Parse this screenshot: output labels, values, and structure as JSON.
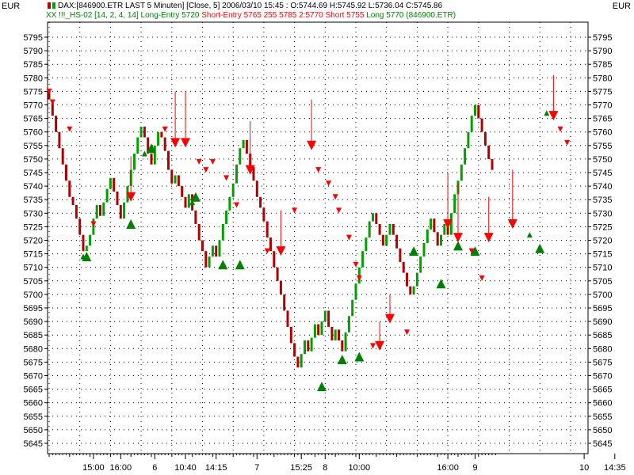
{
  "chart_data": {
    "type": "candlestick",
    "currency_left": "EUR",
    "currency_right": "EUR",
    "title": "DAX:[846900.ETR LAST 5 Minuten] [Close, 5] 2006/03/10 15:45 : O:5744.69 H:5745.92 L:5736.04 C:5745.86",
    "indicator": {
      "name": "XX !!!_HS-02 [14, 2, 4, 14]",
      "long_entry": "Long-Entry 5720",
      "short_entry": "Short-Entry 5765 255 5785 2:5770",
      "short": "Short 5755",
      "long": "Long 5770 (846900.ETR)"
    },
    "ylim": [
      5640,
      5800
    ],
    "y_ticks": [
      5795,
      5790,
      5785,
      5780,
      5775,
      5770,
      5765,
      5760,
      5755,
      5750,
      5745,
      5740,
      5735,
      5730,
      5725,
      5720,
      5715,
      5710,
      5705,
      5700,
      5695,
      5690,
      5685,
      5680,
      5675,
      5670,
      5665,
      5660,
      5655,
      5650,
      5645
    ],
    "x_labels": [
      {
        "i": 13,
        "text": "15:00"
      },
      {
        "i": 21,
        "text": "16:00"
      },
      {
        "i": 31,
        "text": "6"
      },
      {
        "i": 40,
        "text": "10:40"
      },
      {
        "i": 49,
        "text": "14:15"
      },
      {
        "i": 61,
        "text": "7"
      },
      {
        "i": 74,
        "text": "15:25"
      },
      {
        "i": 81,
        "text": "8"
      },
      {
        "i": 91,
        "text": "10:00"
      },
      {
        "i": 117,
        "text": "16:00"
      },
      {
        "i": 125,
        "text": "9"
      },
      {
        "i": 157,
        "text": "10"
      },
      {
        "i": 166,
        "text": "14:35"
      }
    ],
    "closes": [
      5772,
      5766,
      5760,
      5754,
      5748,
      5742,
      5736,
      5733,
      5728,
      5722,
      5716,
      5718,
      5722,
      5728,
      5733,
      5729,
      5734,
      5739,
      5743,
      5738,
      5733,
      5728,
      5734,
      5740,
      5746,
      5752,
      5758,
      5762,
      5758,
      5752,
      5748,
      5755,
      5760,
      5758,
      5753,
      5746,
      5741,
      5744,
      5740,
      5736,
      5732,
      5737,
      5731,
      5726,
      5720,
      5716,
      5710,
      5714,
      5718,
      5714,
      5720,
      5726,
      5731,
      5736,
      5741,
      5748,
      5754,
      5757,
      5752,
      5747,
      5742,
      5736,
      5732,
      5727,
      5721,
      5716,
      5710,
      5705,
      5700,
      5694,
      5688,
      5682,
      5677,
      5673,
      5678,
      5683,
      5679,
      5684,
      5689,
      5685,
      5690,
      5694,
      5688,
      5683,
      5687,
      5683,
      5679,
      5686,
      5692,
      5698,
      5704,
      5710,
      5716,
      5721,
      5727,
      5730,
      5726,
      5722,
      5718,
      5722,
      5726,
      5722,
      5717,
      5712,
      5708,
      5703,
      5700,
      5703,
      5708,
      5714,
      5719,
      5724,
      5728,
      5723,
      5718,
      5722,
      5726,
      5722,
      5730,
      5737,
      5742,
      5748,
      5754,
      5760,
      5766,
      5770,
      5765,
      5760,
      5755,
      5750,
      5746
    ],
    "short_markers": [
      {
        "i": 0,
        "v": 5775,
        "big": false,
        "tail": 0
      },
      {
        "i": 1,
        "v": 5771,
        "big": false,
        "tail": 0
      },
      {
        "i": 6,
        "v": 5761,
        "big": false,
        "tail": 0
      },
      {
        "i": 13,
        "v": 5726,
        "big": false,
        "tail": 0
      },
      {
        "i": 24,
        "v": 5736,
        "big": true,
        "tail": 5751
      },
      {
        "i": 34,
        "v": 5761,
        "big": false,
        "tail": 0
      },
      {
        "i": 37,
        "v": 5756,
        "big": true,
        "tail": 5775
      },
      {
        "i": 40,
        "v": 5756,
        "big": true,
        "tail": 5775
      },
      {
        "i": 44,
        "v": 5749,
        "big": false,
        "tail": 0
      },
      {
        "i": 46,
        "v": 5746,
        "big": false,
        "tail": 0
      },
      {
        "i": 48,
        "v": 5749,
        "big": false,
        "tail": 0
      },
      {
        "i": 52,
        "v": 5743,
        "big": false,
        "tail": 0
      },
      {
        "i": 55,
        "v": 5733,
        "big": false,
        "tail": 0
      },
      {
        "i": 59,
        "v": 5746,
        "big": true,
        "tail": 5764
      },
      {
        "i": 64,
        "v": 5716,
        "big": false,
        "tail": 0
      },
      {
        "i": 68,
        "v": 5716,
        "big": true,
        "tail": 5731
      },
      {
        "i": 72,
        "v": 5731,
        "big": false,
        "tail": 0
      },
      {
        "i": 77,
        "v": 5755,
        "big": true,
        "tail": 5772
      },
      {
        "i": 79,
        "v": 5746,
        "big": false,
        "tail": 0
      },
      {
        "i": 82,
        "v": 5741,
        "big": false,
        "tail": 0
      },
      {
        "i": 84,
        "v": 5736,
        "big": false,
        "tail": 0
      },
      {
        "i": 85,
        "v": 5731,
        "big": false,
        "tail": 0
      },
      {
        "i": 88,
        "v": 5721,
        "big": false,
        "tail": 0
      },
      {
        "i": 90,
        "v": 5711,
        "big": false,
        "tail": 0
      },
      {
        "i": 91,
        "v": 5706,
        "big": false,
        "tail": 0
      },
      {
        "i": 95,
        "v": 5681,
        "big": false,
        "tail": 0
      },
      {
        "i": 97,
        "v": 5681,
        "big": true,
        "tail": 5690
      },
      {
        "i": 100,
        "v": 5691,
        "big": true,
        "tail": 5700
      },
      {
        "i": 105,
        "v": 5686,
        "big": false,
        "tail": 0
      },
      {
        "i": 117,
        "v": 5726,
        "big": true,
        "tail": 5745
      },
      {
        "i": 120,
        "v": 5721,
        "big": true,
        "tail": 5741
      },
      {
        "i": 124,
        "v": 5716,
        "big": false,
        "tail": 0
      },
      {
        "i": 127,
        "v": 5706,
        "big": false,
        "tail": 0
      },
      {
        "i": 129,
        "v": 5721,
        "big": true,
        "tail": 5736
      },
      {
        "i": 136,
        "v": 5726,
        "big": true,
        "tail": 5746
      },
      {
        "i": 148,
        "v": 5766,
        "big": true,
        "tail": 5781
      },
      {
        "i": 150,
        "v": 5761,
        "big": false,
        "tail": 0
      },
      {
        "i": 152,
        "v": 5756,
        "big": false,
        "tail": 0
      }
    ],
    "long_markers": [
      {
        "i": 10,
        "v": 5714,
        "big": false
      },
      {
        "i": 11,
        "v": 5714,
        "big": true
      },
      {
        "i": 24,
        "v": 5726,
        "big": true
      },
      {
        "i": 28,
        "v": 5752,
        "big": false
      },
      {
        "i": 30,
        "v": 5754,
        "big": true
      },
      {
        "i": 42,
        "v": 5734,
        "big": false
      },
      {
        "i": 43,
        "v": 5736,
        "big": true
      },
      {
        "i": 51,
        "v": 5711,
        "big": true
      },
      {
        "i": 56,
        "v": 5711,
        "big": true
      },
      {
        "i": 80,
        "v": 5666,
        "big": true
      },
      {
        "i": 86,
        "v": 5676,
        "big": true
      },
      {
        "i": 91,
        "v": 5677,
        "big": true
      },
      {
        "i": 107,
        "v": 5716,
        "big": true
      },
      {
        "i": 115,
        "v": 5704,
        "big": true
      },
      {
        "i": 120,
        "v": 5718,
        "big": true
      },
      {
        "i": 125,
        "v": 5716,
        "big": true
      },
      {
        "i": 141,
        "v": 5722,
        "big": false
      },
      {
        "i": 144,
        "v": 5717,
        "big": true
      },
      {
        "i": 146,
        "v": 5767,
        "big": false
      }
    ],
    "colors": {
      "up": "#00a000",
      "down": "#b00000",
      "short_marker": "#ff0000",
      "long_marker": "#008000",
      "grid": "#000000",
      "indicator_green": "#008000",
      "indicator_red": "#ff0000"
    }
  }
}
